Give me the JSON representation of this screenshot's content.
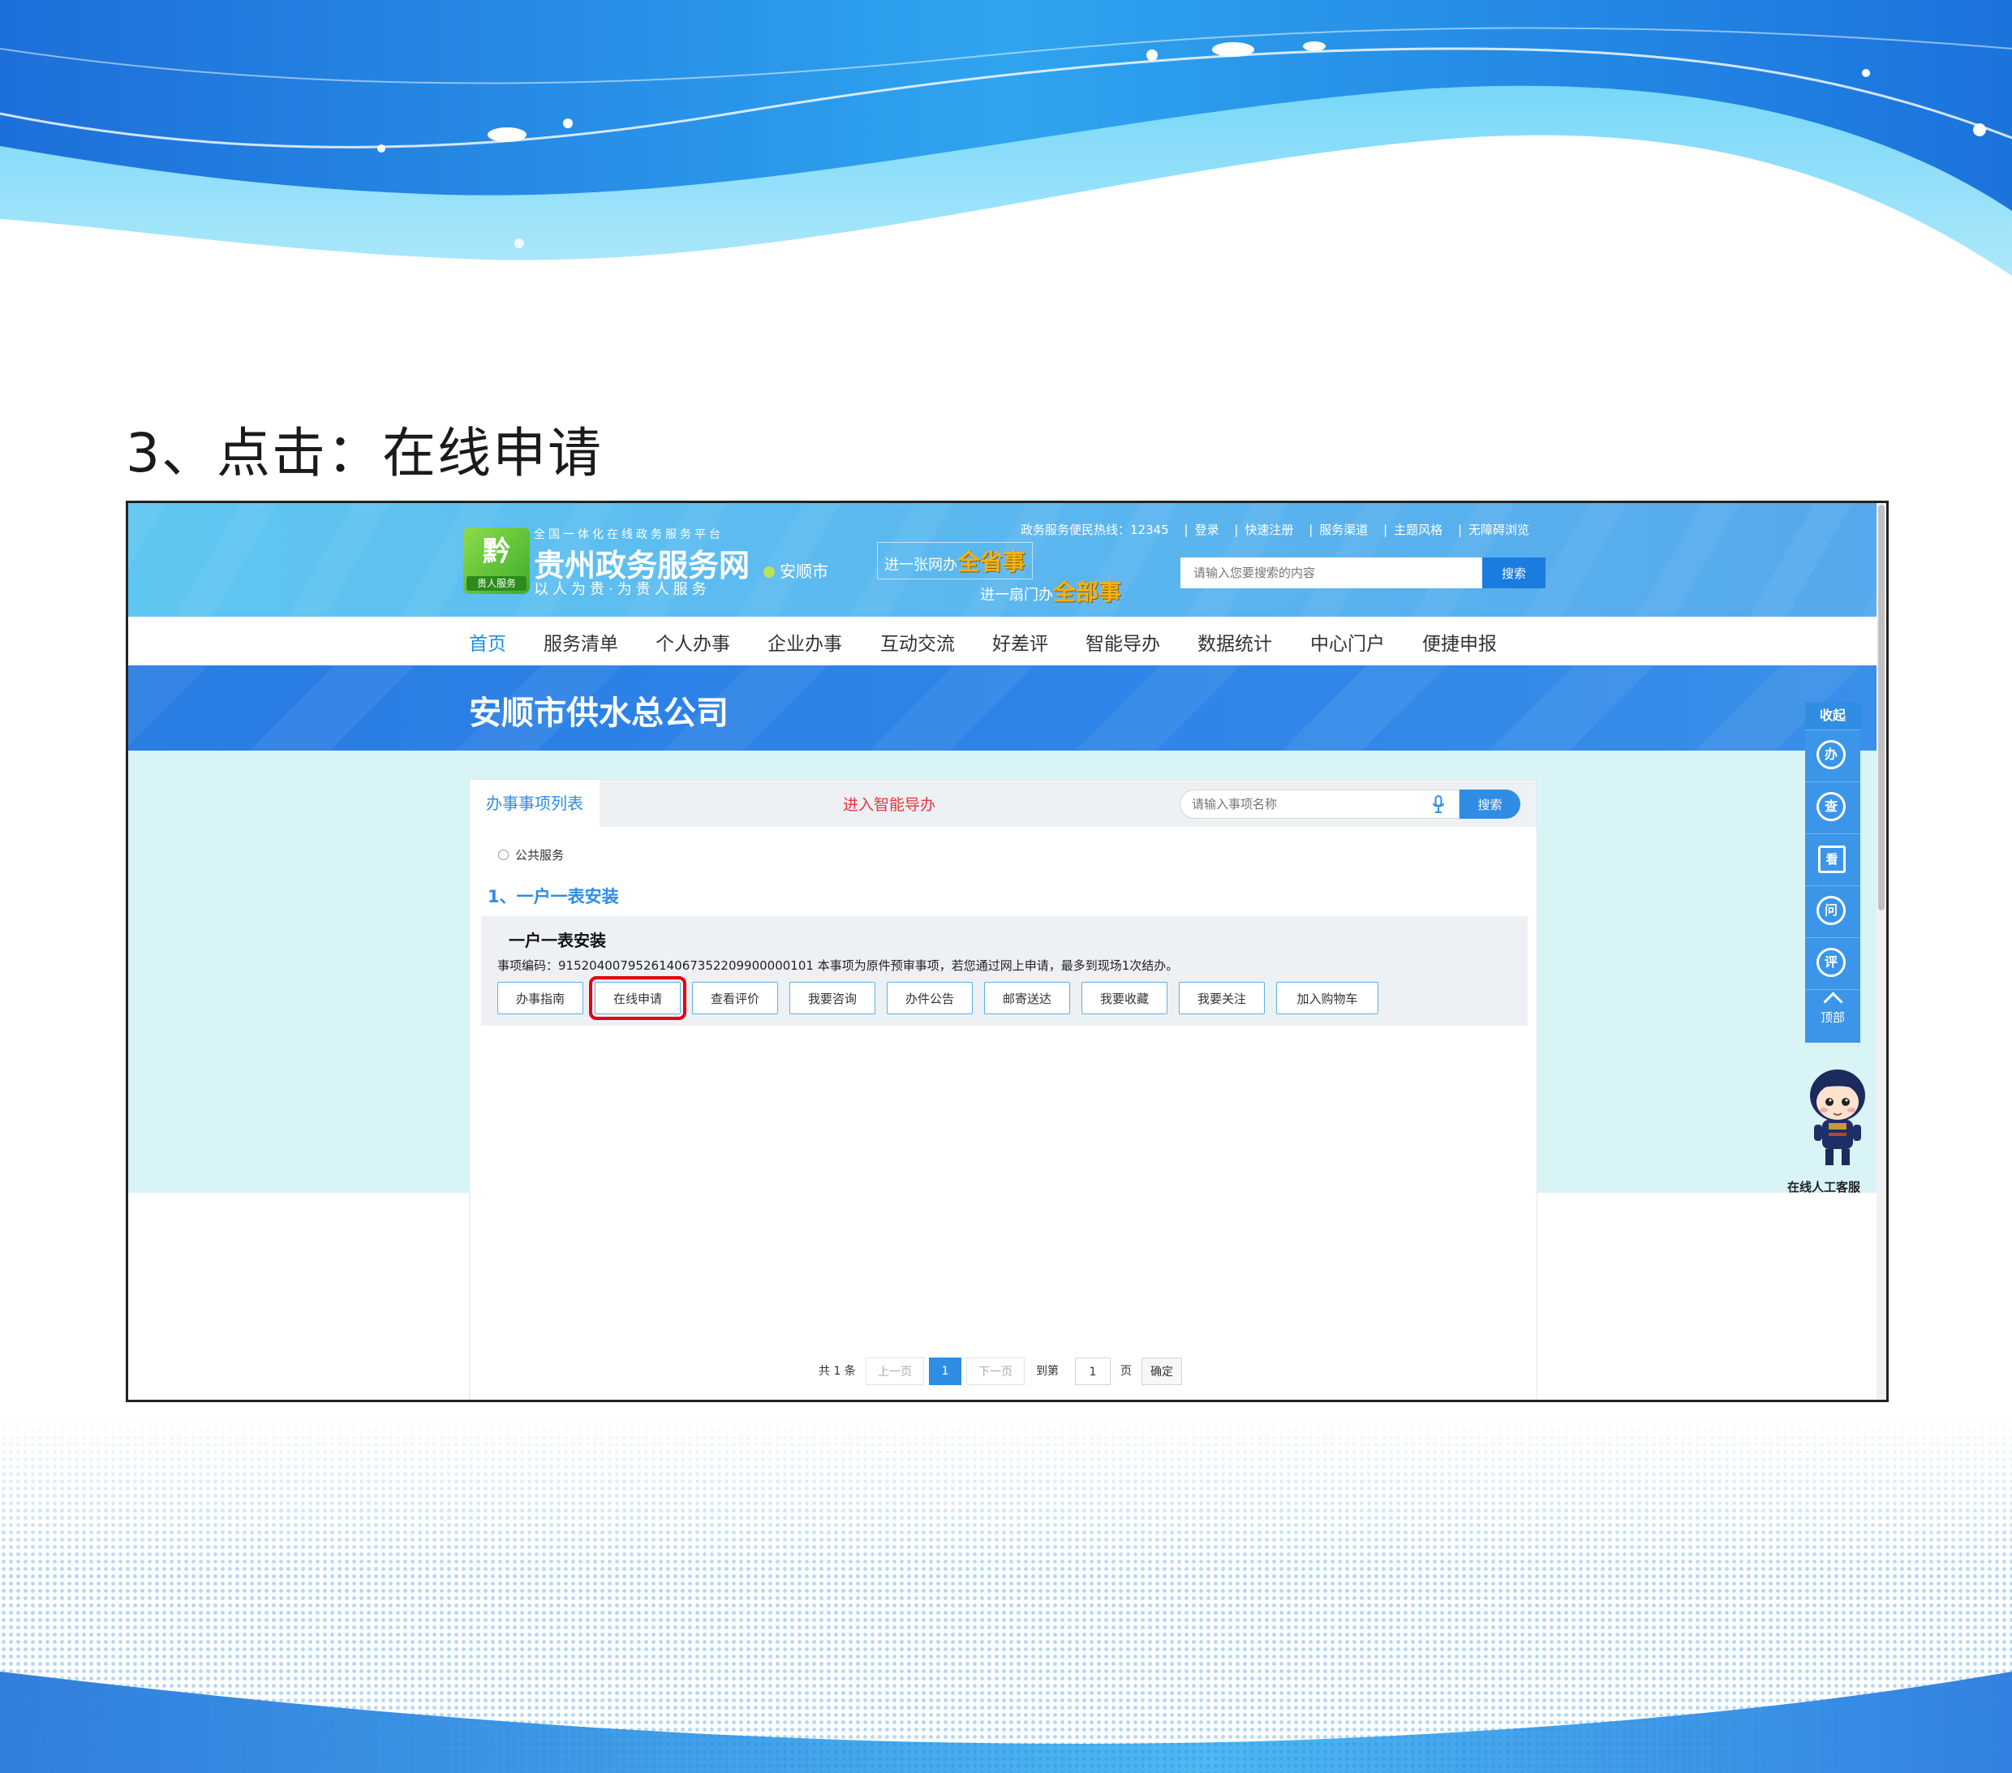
{
  "slide": {
    "step_title": "3、点击：在线申请"
  },
  "header": {
    "logo_glyph": "黔",
    "logo_tag": "贵人服务",
    "platform_label": "全国一体化在线政务服务平台",
    "site_name": "贵州政务服务网",
    "site_slogan": "以人为贵·为贵人服务",
    "city": "安顺市",
    "slogan_1_prefix": "进一张网办",
    "slogan_1_big": "全省事",
    "slogan_2_prefix": "进一扇门办",
    "slogan_2_big": "全部事",
    "hotline": "政务服务便民热线：12345",
    "links": [
      "登录",
      "快速注册",
      "服务渠道",
      "主题风格",
      "无障碍浏览"
    ],
    "search_placeholder": "请输入您要搜索的内容",
    "search_button": "搜索"
  },
  "nav": {
    "items": [
      "首页",
      "服务清单",
      "个人办事",
      "企业办事",
      "互动交流",
      "好差评",
      "智能导办",
      "数据统计",
      "中心门户",
      "便捷申报"
    ],
    "active": "首页"
  },
  "banner": {
    "title": "安顺市供水总公司"
  },
  "panel": {
    "tab_label": "办事事项列表",
    "smart_link": "进入智能导办",
    "search_placeholder": "请输入事项名称",
    "search_button": "搜索",
    "category": "公共服务",
    "section_title": "1、一户一表安装",
    "item": {
      "name": "一户一表安装",
      "code_line": "事项编码：9152040079526140673522099000001​01 本事项为原件预审事项，若您通过网上申请，最多到现场1次结办。",
      "buttons": [
        "办事指南",
        "在线申请",
        "查看评价",
        "我要咨询",
        "办件公告",
        "邮寄送达",
        "我要收藏",
        "我要关注",
        "加入购物车"
      ],
      "highlighted_button": "在线申请"
    },
    "pager": {
      "total": "共 1 条",
      "prev": "上一页",
      "current": "1",
      "next": "下一页",
      "goto": "到第",
      "page_input": "1",
      "page_unit": "页",
      "confirm": "确定"
    }
  },
  "sidebar": {
    "collapse": "收起",
    "items": [
      "办",
      "查",
      "看",
      "问",
      "评"
    ],
    "top": "顶部"
  },
  "mascot": {
    "label": "在线人工客服"
  },
  "colors": {
    "accent": "#2f8de4",
    "highlight_border": "#e50012",
    "smart_link": "#e8333a"
  }
}
